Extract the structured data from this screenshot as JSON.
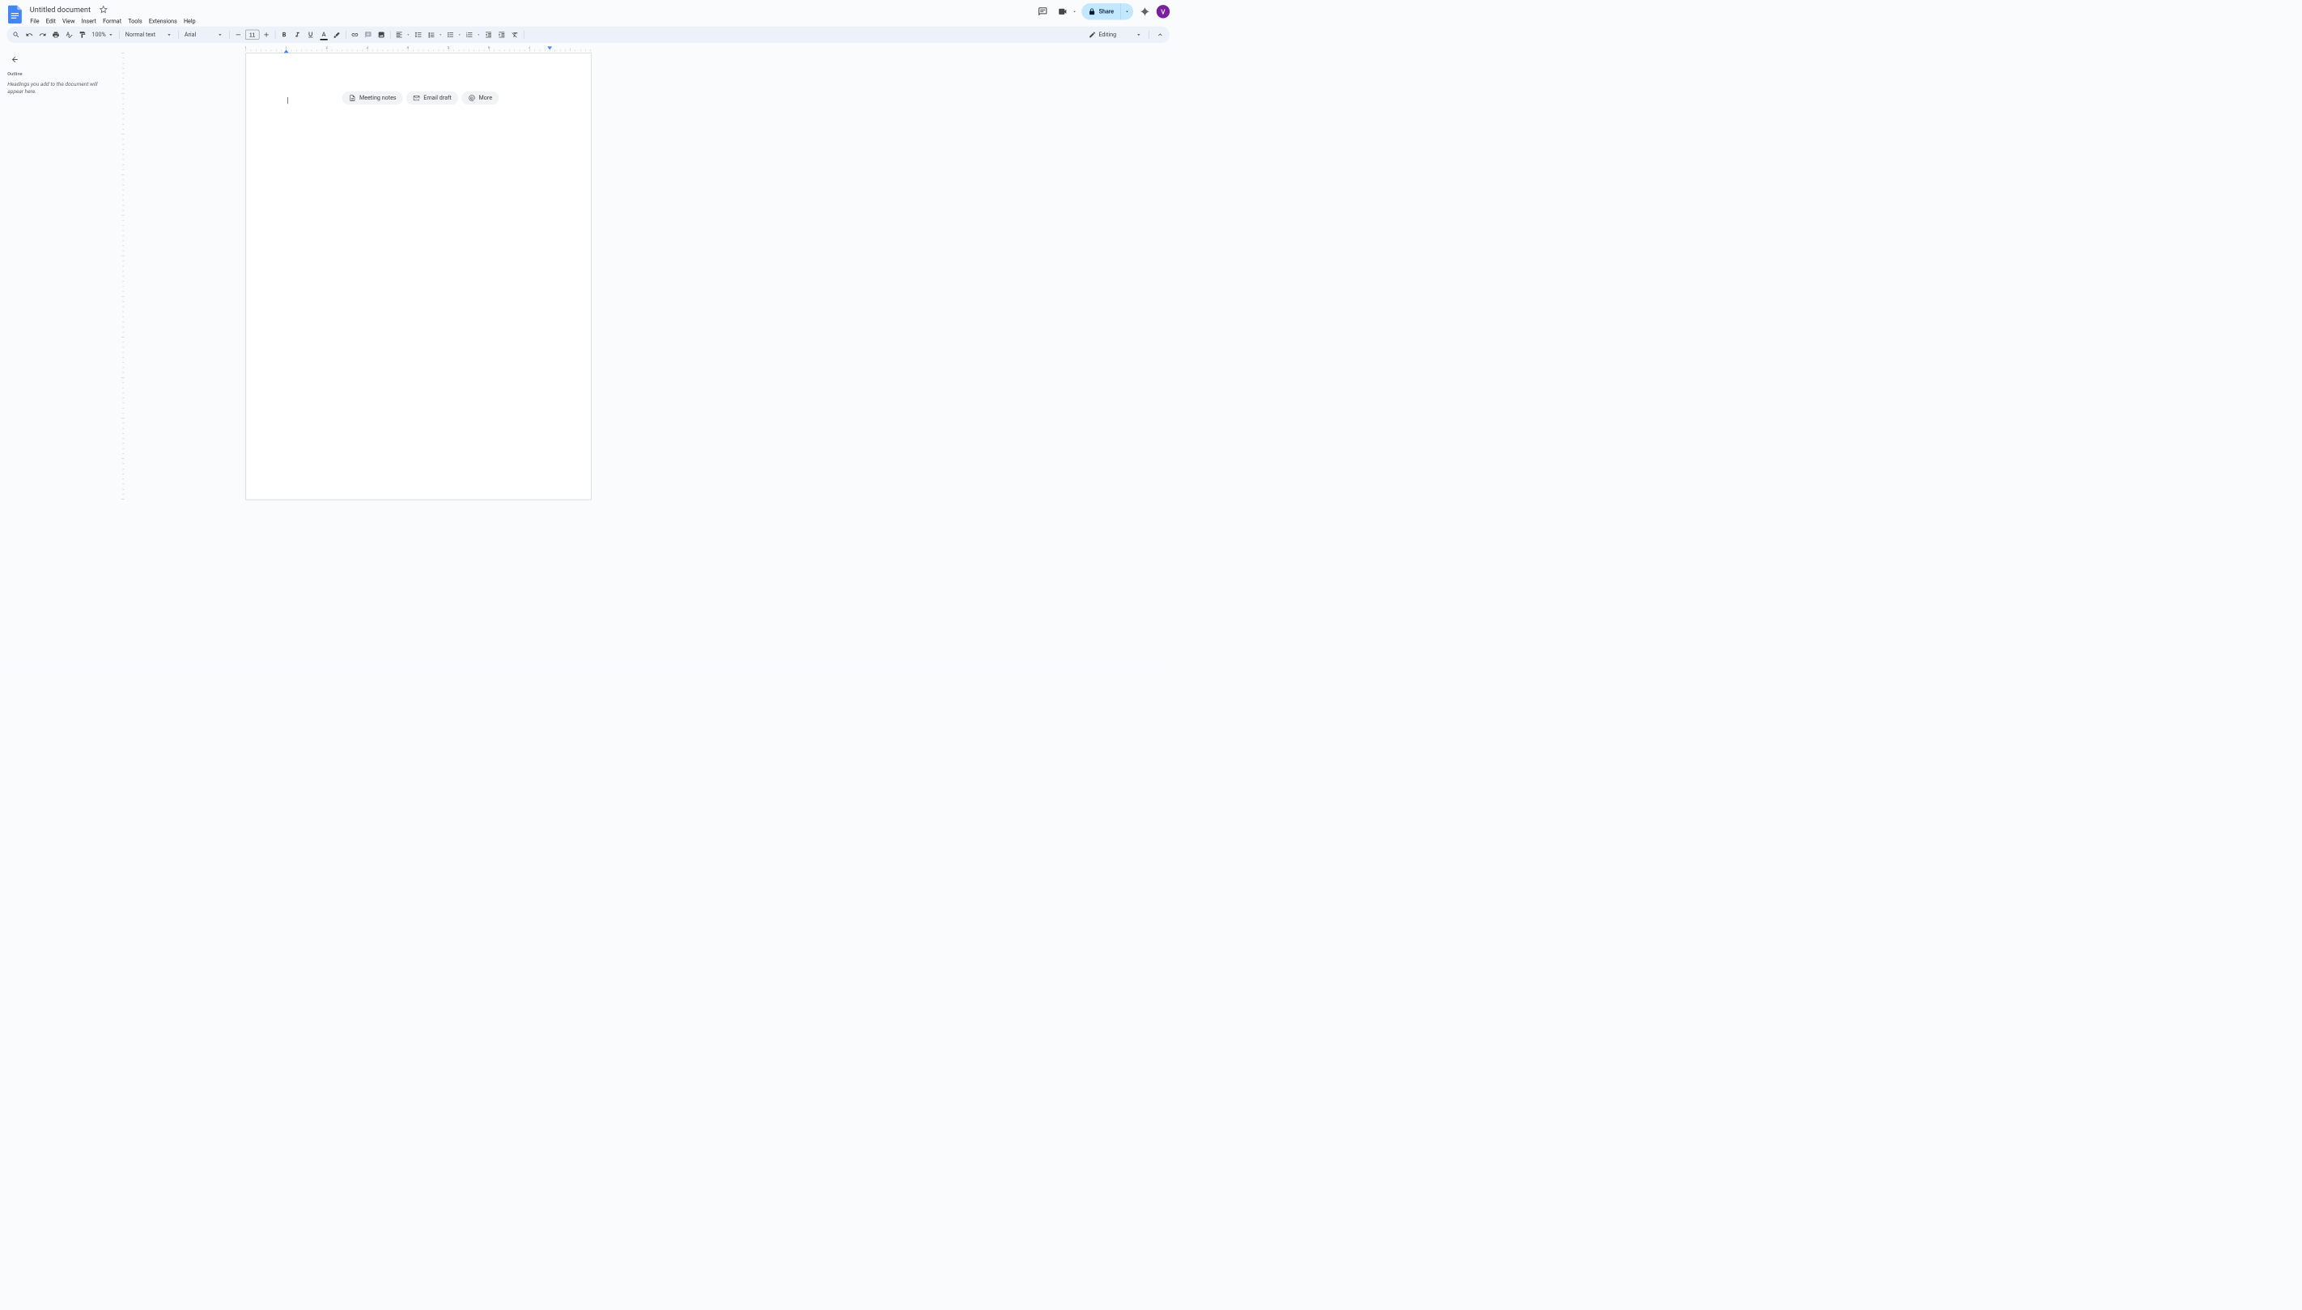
{
  "doc": {
    "title": "Untitled document",
    "starred": false,
    "avatar_initial": "V",
    "share_label": "Share"
  },
  "menubar": [
    "File",
    "Edit",
    "View",
    "Insert",
    "Format",
    "Tools",
    "Extensions",
    "Help"
  ],
  "toolbar": {
    "zoom": "100%",
    "style": "Normal text",
    "font": "Arial",
    "font_size": "11",
    "mode": "Editing"
  },
  "ruler": {
    "h_numbers": [
      1,
      1,
      2,
      3,
      4,
      5,
      6,
      7
    ],
    "left_indent_in": 1.0,
    "right_indent_in": 7.5,
    "pixels_per_inch": 98
  },
  "sidebar": {
    "title": "Outline",
    "hint": "Headings you add to the document will appear here."
  },
  "chips": {
    "meeting": "Meeting notes",
    "email": "Email draft",
    "more": "More"
  },
  "icons": {
    "comments": "comments-icon",
    "meet": "meet-icon",
    "lock": "lock-icon",
    "spark": "spark-icon"
  }
}
